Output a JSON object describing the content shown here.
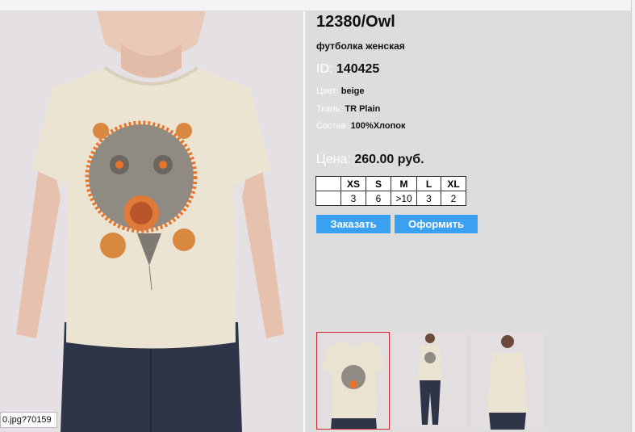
{
  "product": {
    "title": "12380/Owl",
    "subtitle": "футболка женская",
    "id_label": "ID:",
    "id_value": "140425",
    "color_label": "Цвет:",
    "color_value": "beige",
    "fabric_label": "Ткань:",
    "fabric_value": "TR Plain",
    "composition_label": "Состав:",
    "composition_value": "100%Хлопок",
    "price_label": "Цена:",
    "price_value": "260.00 руб."
  },
  "sizes": {
    "headers": [
      "",
      "XS",
      "S",
      "M",
      "L",
      "XL"
    ],
    "stock": [
      "",
      "3",
      "6",
      ">10",
      "3",
      "2"
    ]
  },
  "buttons": {
    "order": "Заказать",
    "checkout": "Оформить"
  },
  "thumbnails": [
    {
      "name": "front-closeup",
      "selected": true
    },
    {
      "name": "front-full",
      "selected": false
    },
    {
      "name": "back-view",
      "selected": false
    }
  ],
  "statusbar": {
    "text": "0.jpg?70159"
  },
  "colors": {
    "panel_bg": "#dddddd",
    "button": "#3aa0f0",
    "selected_border": "#d0262b",
    "shirt": "#ebe3d2",
    "accent_orange": "#e8742a"
  }
}
